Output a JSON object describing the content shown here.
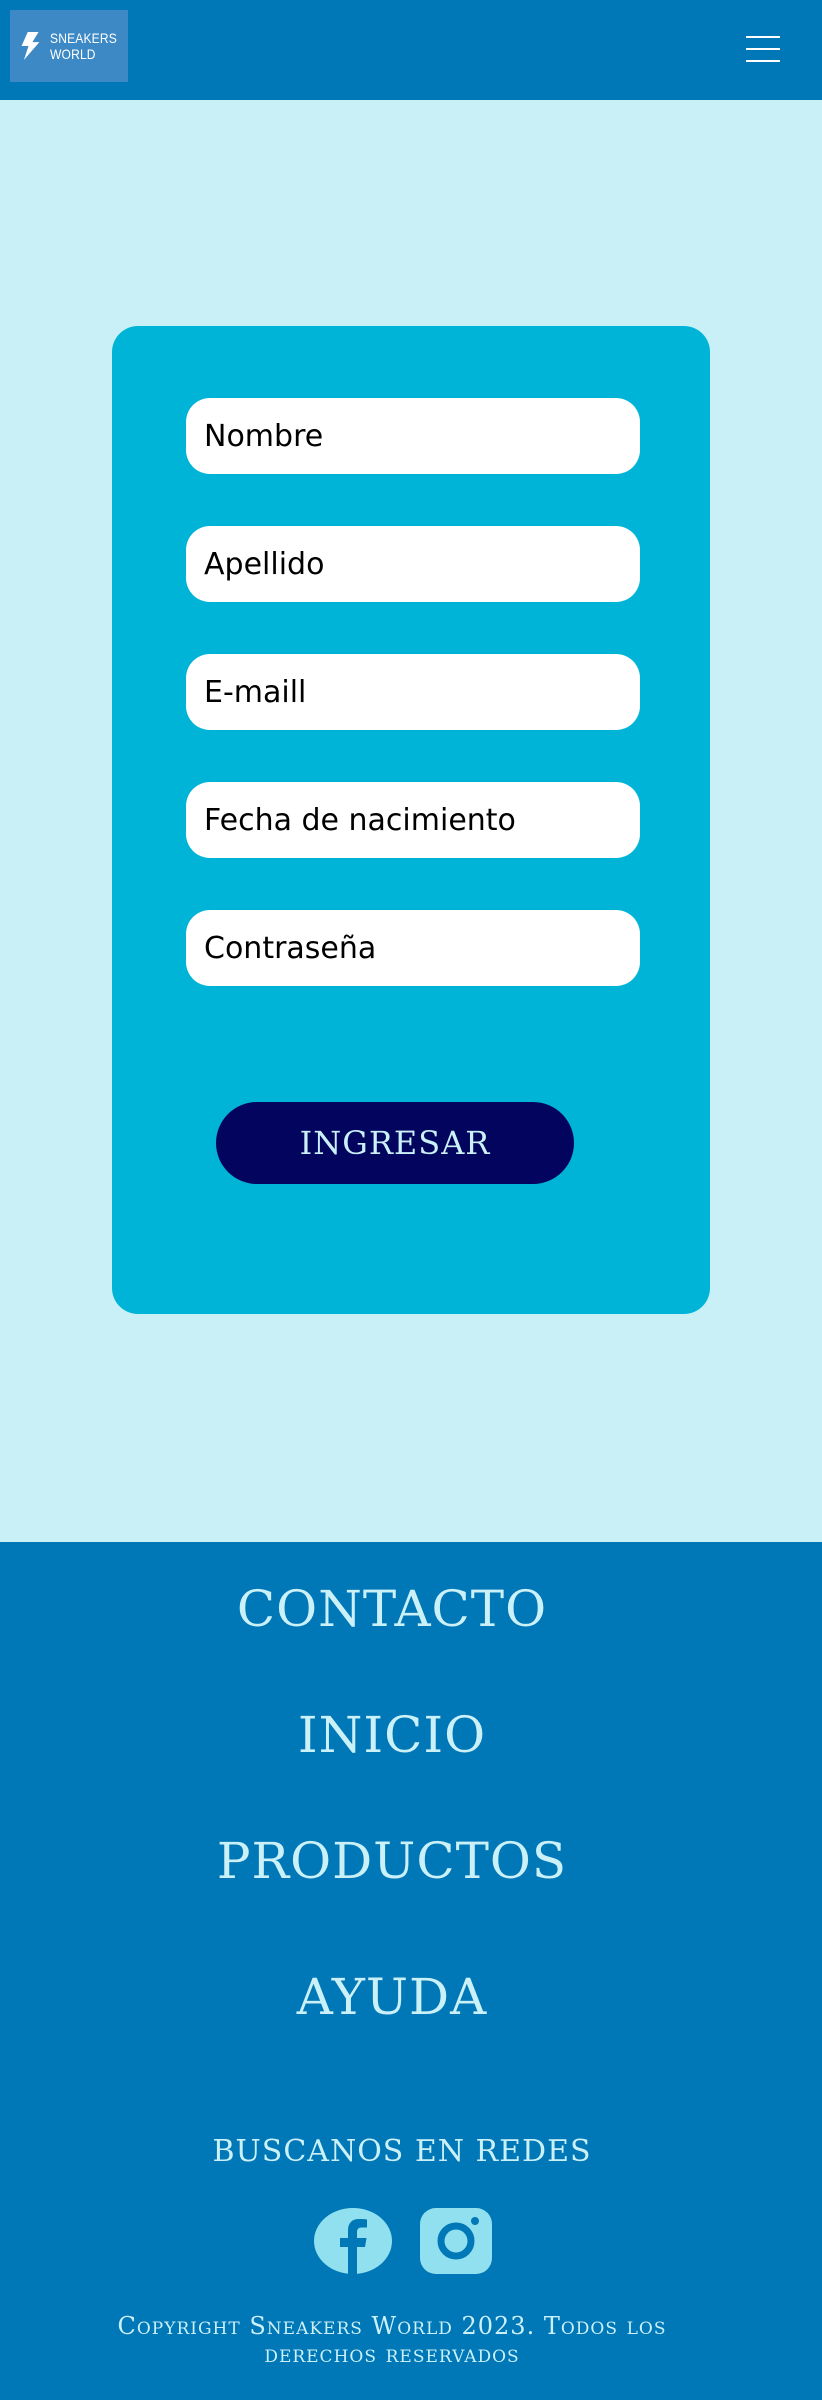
{
  "header": {
    "logo_line1": "SNEAKERS",
    "logo_line2": "WORLD",
    "menu_icon": "hamburger-menu-icon"
  },
  "form": {
    "fields": [
      {
        "placeholder": "Nombre"
      },
      {
        "placeholder": "Apellido"
      },
      {
        "placeholder": "E-maill"
      },
      {
        "placeholder": "Fecha de nacimiento"
      },
      {
        "placeholder": "Contraseña"
      }
    ],
    "submit_label": "INGRESAR"
  },
  "footer": {
    "nav": [
      "CONTACTO",
      "INICIO",
      "PRODUCTOS",
      "AYUDA"
    ],
    "social_title": "BUSCANOS EN REDES",
    "social_icons": [
      "facebook-icon",
      "instagram-icon"
    ],
    "copyright_line1": "Copyright Sneakers World 2023. Todos los",
    "copyright_line2": "derechos reservados"
  },
  "colors": {
    "header_bg": "#0077b6",
    "page_bg": "#c9f0f7",
    "card_bg": "#00b4d8",
    "button_bg": "#03045e",
    "footer_text": "#caf0f8",
    "social_icon": "#90e0ef"
  }
}
